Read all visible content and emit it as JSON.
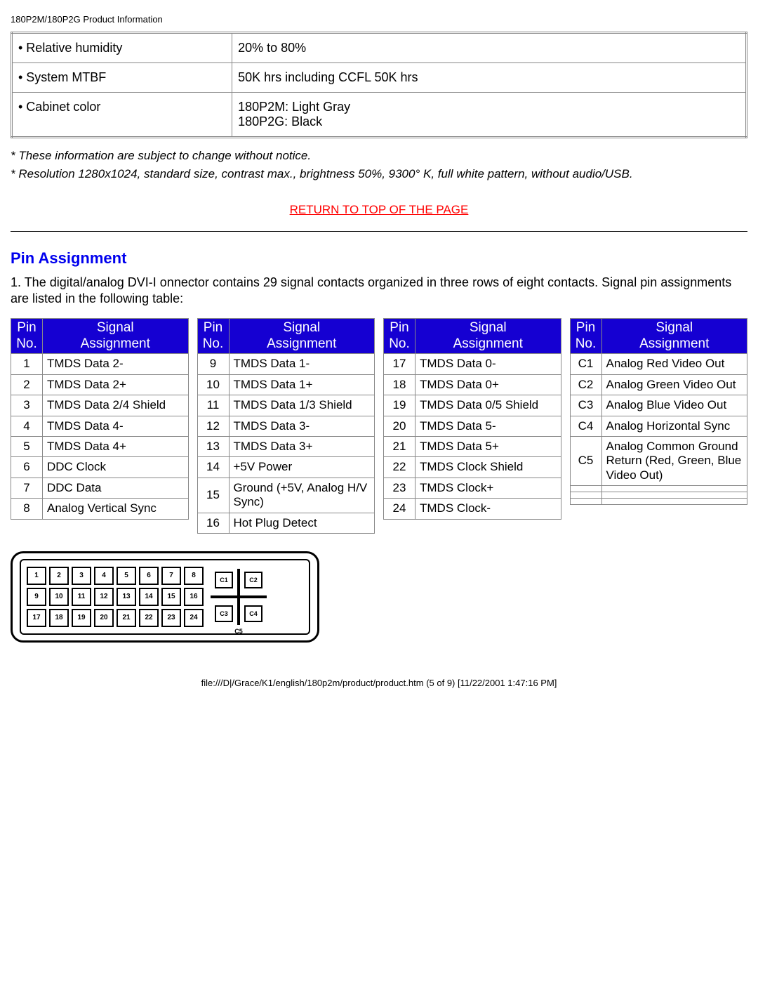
{
  "header": "180P2M/180P2G Product Information",
  "spec_table": {
    "rows": [
      {
        "label": "• Relative humidity",
        "value": "20% to 80%"
      },
      {
        "label": "• System MTBF",
        "value": "50K hrs including CCFL 50K hrs"
      },
      {
        "label": "• Cabinet color",
        "value": "180P2M: Light Gray\n180P2G: Black"
      }
    ]
  },
  "notes": {
    "line1": "* These information are subject to change without notice.",
    "line2": "* Resolution 1280x1024, standard size, contrast max., brightness 50%, 9300° K, full white pattern, without audio/USB."
  },
  "return_link": "RETURN TO TOP OF THE PAGE",
  "section_title": "Pin Assignment",
  "intro": "1. The digital/analog DVI-I onnector contains 29 signal contacts organized in three rows of eight contacts. Signal pin assignments are listed in the following table:",
  "pin_headers": {
    "pin": "Pin No.",
    "signal": "Signal Assignment"
  },
  "pin_columns": [
    [
      {
        "no": "1",
        "sig": "TMDS Data 2-"
      },
      {
        "no": "2",
        "sig": "TMDS Data 2+"
      },
      {
        "no": "3",
        "sig": "TMDS Data 2/4 Shield"
      },
      {
        "no": "4",
        "sig": "TMDS Data 4-"
      },
      {
        "no": "5",
        "sig": "TMDS Data 4+"
      },
      {
        "no": "6",
        "sig": "DDC Clock"
      },
      {
        "no": "7",
        "sig": "DDC Data"
      },
      {
        "no": "8",
        "sig": "Analog Vertical Sync"
      }
    ],
    [
      {
        "no": "9",
        "sig": "TMDS Data 1-"
      },
      {
        "no": "10",
        "sig": "TMDS Data 1+"
      },
      {
        "no": "11",
        "sig": "TMDS Data 1/3 Shield"
      },
      {
        "no": "12",
        "sig": "TMDS Data 3-"
      },
      {
        "no": "13",
        "sig": "TMDS Data 3+"
      },
      {
        "no": "14",
        "sig": "+5V Power"
      },
      {
        "no": "15",
        "sig": "Ground (+5V, Analog H/V Sync)"
      },
      {
        "no": "16",
        "sig": "Hot Plug Detect"
      }
    ],
    [
      {
        "no": "17",
        "sig": "TMDS Data 0-"
      },
      {
        "no": "18",
        "sig": "TMDS Data 0+"
      },
      {
        "no": "19",
        "sig": "TMDS Data 0/5 Shield"
      },
      {
        "no": "20",
        "sig": "TMDS Data 5-"
      },
      {
        "no": "21",
        "sig": "TMDS Data 5+"
      },
      {
        "no": "22",
        "sig": "TMDS Clock Shield"
      },
      {
        "no": "23",
        "sig": "TMDS Clock+"
      },
      {
        "no": "24",
        "sig": "TMDS Clock-"
      }
    ],
    [
      {
        "no": "C1",
        "sig": "Analog Red Video Out"
      },
      {
        "no": "C2",
        "sig": "Analog Green Video Out"
      },
      {
        "no": "C3",
        "sig": "Analog Blue Video Out"
      },
      {
        "no": "C4",
        "sig": "Analog Horizontal Sync"
      },
      {
        "no": "C5",
        "sig": "Analog Common Ground Return (Red, Green, Blue Video Out)"
      },
      {
        "no": "",
        "sig": ""
      },
      {
        "no": "",
        "sig": ""
      },
      {
        "no": "",
        "sig": ""
      }
    ]
  ],
  "connector": {
    "grid_labels": [
      "1",
      "2",
      "3",
      "4",
      "5",
      "6",
      "7",
      "8",
      "9",
      "10",
      "11",
      "12",
      "13",
      "14",
      "15",
      "16",
      "17",
      "18",
      "19",
      "20",
      "21",
      "22",
      "23",
      "24"
    ],
    "c_labels": {
      "c1": "C1",
      "c2": "C2",
      "c3": "C3",
      "c4": "C4",
      "c5": "C5"
    }
  },
  "footer": "file:///D|/Grace/K1/english/180p2m/product/product.htm (5 of 9) [11/22/2001 1:47:16 PM]"
}
